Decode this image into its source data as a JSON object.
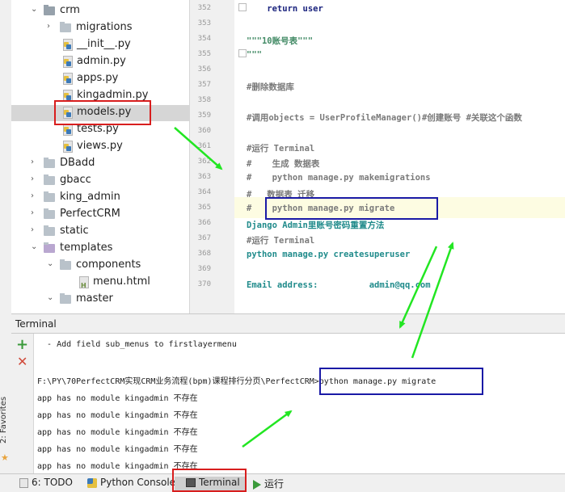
{
  "left_strip": {
    "favorites_label": "2: Favorites"
  },
  "tree": {
    "items": [
      {
        "label": "crm"
      },
      {
        "label": "migrations"
      },
      {
        "label": "__init__.py"
      },
      {
        "label": "admin.py"
      },
      {
        "label": "apps.py"
      },
      {
        "label": "kingadmin.py"
      },
      {
        "label": "models.py"
      },
      {
        "label": "tests.py"
      },
      {
        "label": "views.py"
      },
      {
        "label": "DBadd"
      },
      {
        "label": "gbacc"
      },
      {
        "label": "king_admin"
      },
      {
        "label": "PerfectCRM"
      },
      {
        "label": "static"
      },
      {
        "label": "templates"
      },
      {
        "label": "components"
      },
      {
        "label": "menu.html"
      },
      {
        "label": "master"
      }
    ]
  },
  "editor": {
    "lines": [
      {
        "num": "352",
        "text": "    return user"
      },
      {
        "num": "353",
        "text": ""
      },
      {
        "num": "354",
        "text": "\"\"\"10账号表\"\"\""
      },
      {
        "num": "355",
        "text": "\"\"\""
      },
      {
        "num": "356",
        "text": ""
      },
      {
        "num": "357",
        "text": "#删除数据库"
      },
      {
        "num": "358",
        "text": ""
      },
      {
        "num": "359",
        "text": "#调用objects = UserProfileManager()#创建账号 #关联这个函数"
      },
      {
        "num": "360",
        "text": ""
      },
      {
        "num": "361",
        "text": "#运行 Terminal"
      },
      {
        "num": "362",
        "text": "#    生成 数据表"
      },
      {
        "num": "363",
        "text": "#    python manage.py makemigrations"
      },
      {
        "num": "364",
        "text": "#   数据表 迁移"
      },
      {
        "num": "365",
        "text": "#    python manage.py migrate"
      },
      {
        "num": "366",
        "text": "Django Admin里账号密码重置方法"
      },
      {
        "num": "367",
        "text": "#运行 Terminal"
      },
      {
        "num": "368",
        "text": "python manage.py createsuperuser"
      },
      {
        "num": "369",
        "text": ""
      },
      {
        "num": "370",
        "text": "Email address:          admin@qq.com"
      }
    ]
  },
  "terminal": {
    "title": "Terminal",
    "lines": [
      "  - Add field sub_menus to firstlayermenu",
      "",
      "F:\\PY\\70PerfectCRM实现CRM业务流程(bpm)课程排行分页\\PerfectCRM>python manage.py migrate",
      "app has no module kingadmin 不存在",
      "app has no module kingadmin 不存在",
      "app has no module kingadmin 不存在",
      "app has no module kingadmin 不存在",
      "app has no module kingadmin 不存在"
    ]
  },
  "bottombar": {
    "tabs": [
      {
        "label": "6: TODO",
        "icon": "todo-icon"
      },
      {
        "label": "Python Console",
        "icon": "python-console-icon"
      },
      {
        "label": "Terminal",
        "icon": "terminal-icon"
      },
      {
        "label": "运行",
        "icon": "run-icon"
      }
    ]
  },
  "colors": {
    "annotation_red": "#d81e1e",
    "annotation_blue": "#1a1aa6",
    "annotation_arrow_green": "#22e622"
  }
}
